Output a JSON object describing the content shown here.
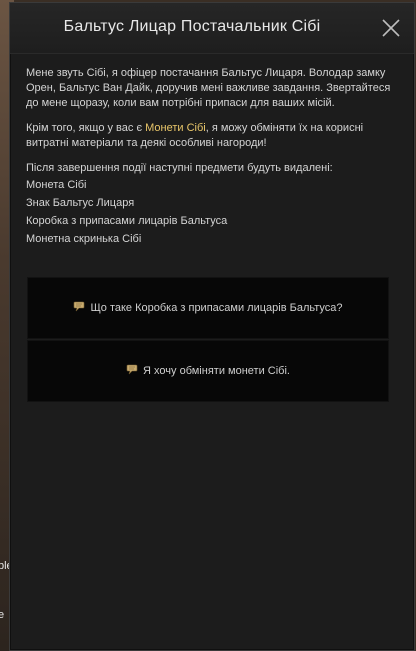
{
  "dialog": {
    "title": "Бальтус Лицар Постачальник Сібі",
    "close_icon": "close-icon"
  },
  "content": {
    "intro": "Мене звуть Сібі, я офіцер постачання Бальтус Лицаря. Володар замку Орен, Бальтус Ван Дайк, доручив мені важливе завдання. Звертайтеся до мене щоразу, коли вам потрібні припаси для ваших місій.",
    "exchange_before": "Крім того, якщо у вас є ",
    "exchange_highlight": "Монети Сібі",
    "exchange_after": ", я можу обміняти їх на корисні витратні матеріали та деякі особливі нагороди!",
    "removal_notice": "Після завершення події наступні предмети будуть видалені:",
    "items": [
      "Монета Сібі",
      "Знак Бальтус Лицаря",
      "Коробка з припасами лицарів Бальтуса",
      "Монетна скринька Сібі"
    ],
    "highlight_color": "#e8c66a"
  },
  "options": [
    {
      "label": "Що таке Коробка з припасами лицарів Бальтуса?",
      "icon": "chat-bubble-icon"
    },
    {
      "label": "Я хочу обміняти монети Сібі.",
      "icon": "chat-bubble-icon"
    }
  ],
  "background_edge": {
    "fragment_1": "ble",
    "fragment_2": "e"
  }
}
